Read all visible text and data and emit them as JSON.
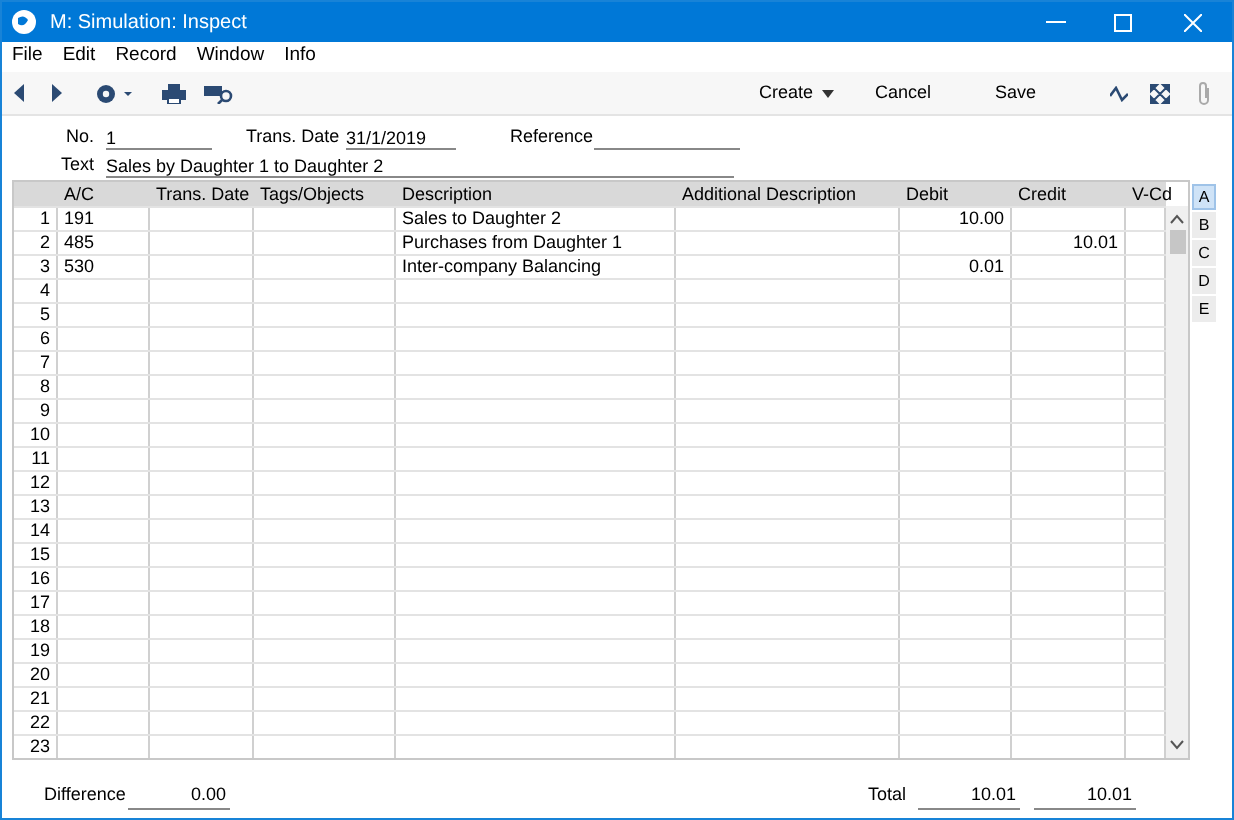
{
  "window": {
    "title": "M: Simulation: Inspect"
  },
  "menu": [
    "File",
    "Edit",
    "Record",
    "Window",
    "Info"
  ],
  "toolbar": {
    "create": "Create",
    "cancel": "Cancel",
    "save": "Save"
  },
  "header": {
    "no_label": "No.",
    "no": "1",
    "date_label": "Trans. Date",
    "date": "31/1/2019",
    "reference_label": "Reference",
    "text_label": "Text",
    "text": "Sales by Daughter 1 to Daughter 2"
  },
  "table": {
    "columns": [
      "A/C",
      "Trans. Date",
      "Tags/Objects",
      "Description",
      "Additional Description",
      "Debit",
      "Credit",
      "V-Cd"
    ],
    "rows": [
      {
        "number": "1",
        "cells": [
          "191",
          "",
          "",
          "Sales to Daughter 2",
          "",
          "10.00",
          "",
          ""
        ]
      },
      {
        "number": "2",
        "cells": [
          "485",
          "",
          "",
          "Purchases from Daughter 1",
          "",
          "",
          "10.01",
          ""
        ]
      },
      {
        "number": "3",
        "cells": [
          "530",
          "",
          "",
          "Inter-company Balancing",
          "",
          "0.01",
          "",
          ""
        ]
      },
      {
        "number": "4"
      },
      {
        "number": "5"
      },
      {
        "number": "6"
      },
      {
        "number": "7"
      },
      {
        "number": "8"
      },
      {
        "number": "9"
      },
      {
        "number": "10"
      },
      {
        "number": "11"
      },
      {
        "number": "12"
      },
      {
        "number": "13"
      },
      {
        "number": "14"
      },
      {
        "number": "15"
      },
      {
        "number": "16"
      },
      {
        "number": "17"
      },
      {
        "number": "18"
      },
      {
        "number": "19"
      },
      {
        "number": "20"
      },
      {
        "number": "21"
      },
      {
        "number": "22"
      },
      {
        "number": "23"
      }
    ]
  },
  "side_tabs": [
    {
      "label": "A",
      "selected": true
    },
    {
      "label": "B",
      "selected": false
    },
    {
      "label": "C",
      "selected": false
    },
    {
      "label": "D",
      "selected": false
    },
    {
      "label": "E",
      "selected": false
    }
  ],
  "footer": {
    "difference_label": "Difference",
    "difference": "0.00",
    "total_label": "Total",
    "total_debit": "10.01",
    "total_credit": "10.01"
  }
}
